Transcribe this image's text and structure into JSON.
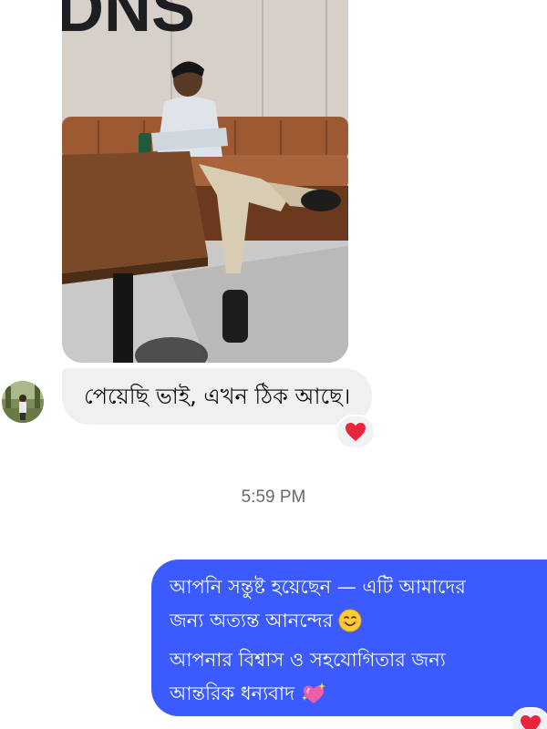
{
  "conversation": {
    "received_message": {
      "text": "পেয়েছি ভাই, এখন ঠিক আছে।",
      "reaction": "red-heart"
    },
    "timestamp": "5:59 PM",
    "sent_message": {
      "lines": [
        "আপনি সন্তুষ্ট হয়েছেন — এটি আমাদের",
        "জন্য অত্যন্ত আনন্দের",
        "আপনার বিশ্বাস ও সহযোগিতার জন্য",
        "আন্তরিক ধন্যবাদ"
      ],
      "emoji_1": "smiling-face-emoji",
      "emoji_2": "sparkling-heart-emoji",
      "reaction": "red-heart"
    }
  },
  "photo_sign_text": "DNS",
  "colors": {
    "sent_bubble": "#3b5bff",
    "received_bubble": "#eef0f2",
    "heart": "#e8253a"
  }
}
